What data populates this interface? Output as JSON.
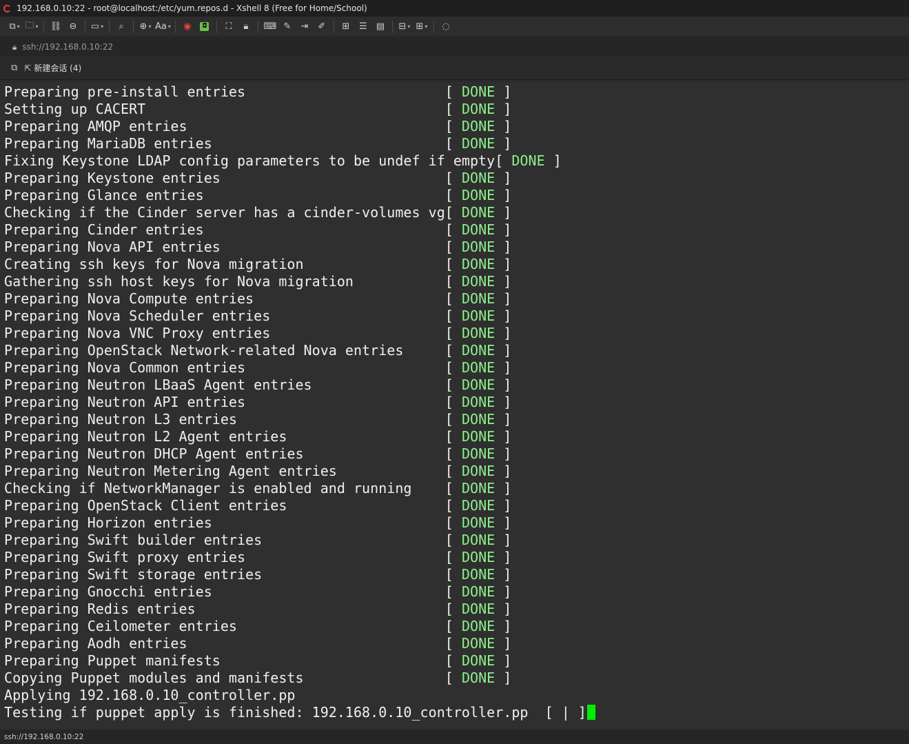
{
  "window": {
    "title": "192.168.0.10:22 - root@localhost:/etc/yum.repos.d - Xshell 8 (Free for Home/School)"
  },
  "address": {
    "url": "ssh://192.168.0.10:22"
  },
  "tab": {
    "label": "新建会话 (4)"
  },
  "terminal": {
    "status_open": "[ ",
    "status_done": "DONE",
    "status_close": " ]",
    "entries": [
      "Preparing pre-install entries",
      "Setting up CACERT",
      "Preparing AMQP entries",
      "Preparing MariaDB entries",
      "Fixing Keystone LDAP config parameters to be undef if empty",
      "Preparing Keystone entries",
      "Preparing Glance entries",
      "Checking if the Cinder server has a cinder-volumes vg",
      "Preparing Cinder entries",
      "Preparing Nova API entries",
      "Creating ssh keys for Nova migration",
      "Gathering ssh host keys for Nova migration",
      "Preparing Nova Compute entries",
      "Preparing Nova Scheduler entries",
      "Preparing Nova VNC Proxy entries",
      "Preparing OpenStack Network-related Nova entries",
      "Preparing Nova Common entries",
      "Preparing Neutron LBaaS Agent entries",
      "Preparing Neutron API entries",
      "Preparing Neutron L3 entries",
      "Preparing Neutron L2 Agent entries",
      "Preparing Neutron DHCP Agent entries",
      "Preparing Neutron Metering Agent entries",
      "Checking if NetworkManager is enabled and running",
      "Preparing OpenStack Client entries",
      "Preparing Horizon entries",
      "Preparing Swift builder entries",
      "Preparing Swift proxy entries",
      "Preparing Swift storage entries",
      "Preparing Gnocchi entries",
      "Preparing Redis entries",
      "Preparing Ceilometer entries",
      "Preparing Aodh entries",
      "Preparing Puppet manifests",
      "Copying Puppet modules and manifests"
    ],
    "applying_line": "Applying 192.168.0.10_controller.pp",
    "testing_line": "Testing if puppet apply is finished: 192.168.0.10_controller.pp  [ | ]",
    "cursor_color": "#00ee00",
    "done_color": "#8df08d"
  },
  "statusbar": {
    "text": "ssh://192.168.0.10:22"
  },
  "toolbar_icons": [
    "new-session-icon",
    "open-folder-icon",
    "reconnect-icon",
    "disconnect-icon",
    "new-window-icon",
    "find-icon",
    "globe-icon",
    "font-icon",
    "xftp-icon",
    "xagent-icon",
    "fullscreen-icon",
    "lock-icon",
    "keyboard-icon",
    "script-icon",
    "transfer-icon",
    "compose-icon",
    "add-icon",
    "log-icon",
    "tile-icon",
    "layout-icon",
    "help-icon"
  ]
}
